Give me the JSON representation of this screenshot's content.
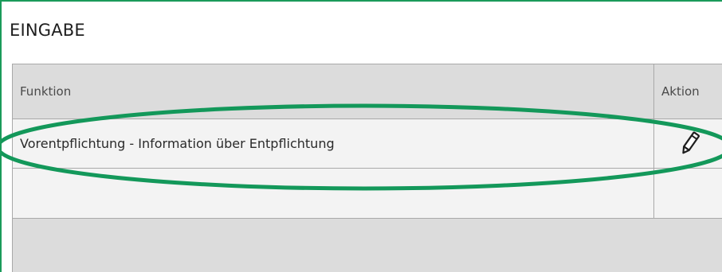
{
  "section": {
    "title": "EINGABE"
  },
  "table": {
    "columns": {
      "function": "Funktion",
      "action": "Aktion"
    },
    "rows": [
      {
        "function": "Vorentpflichtung - Information über Entpflichtung",
        "action_icon": "pencil-icon"
      },
      {
        "function": "",
        "action_icon": ""
      }
    ]
  },
  "colors": {
    "highlight": "#13985a",
    "header_bg": "#dcdcdc",
    "row_bg": "#f3f3f3",
    "border": "#a9a9a9"
  }
}
